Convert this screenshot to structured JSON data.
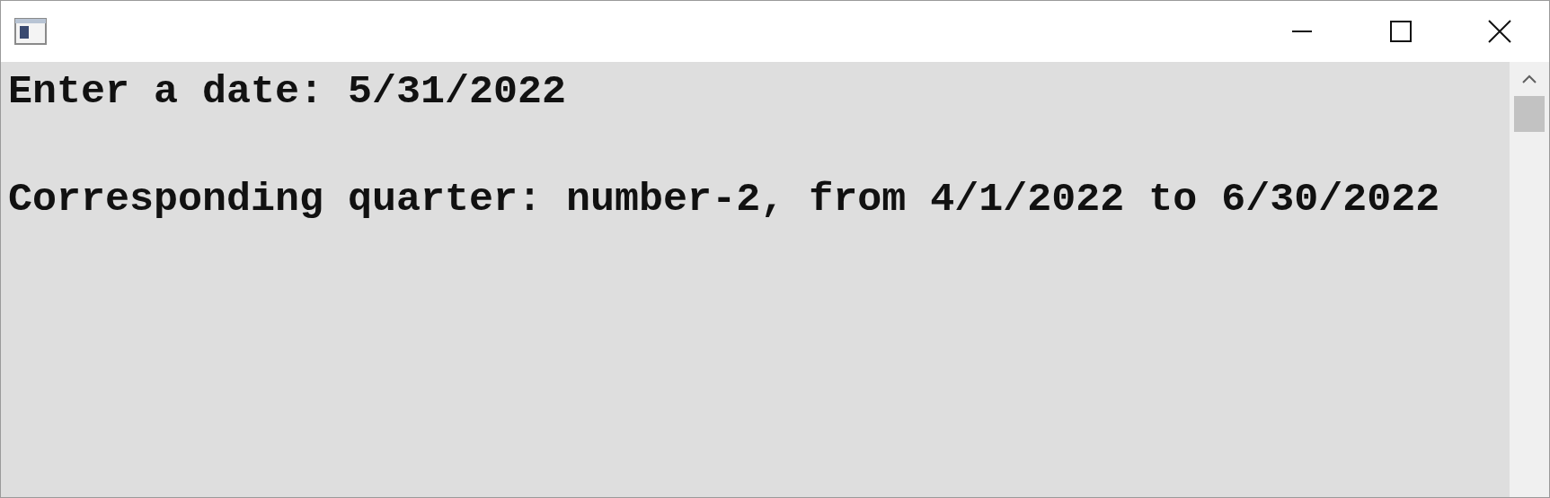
{
  "console": {
    "lines": [
      {
        "text": "Enter a date: 5/31/2022"
      },
      {
        "text": "Corresponding quarter: number-2, from 4/1/2022 to 6/30/2022"
      }
    ]
  }
}
